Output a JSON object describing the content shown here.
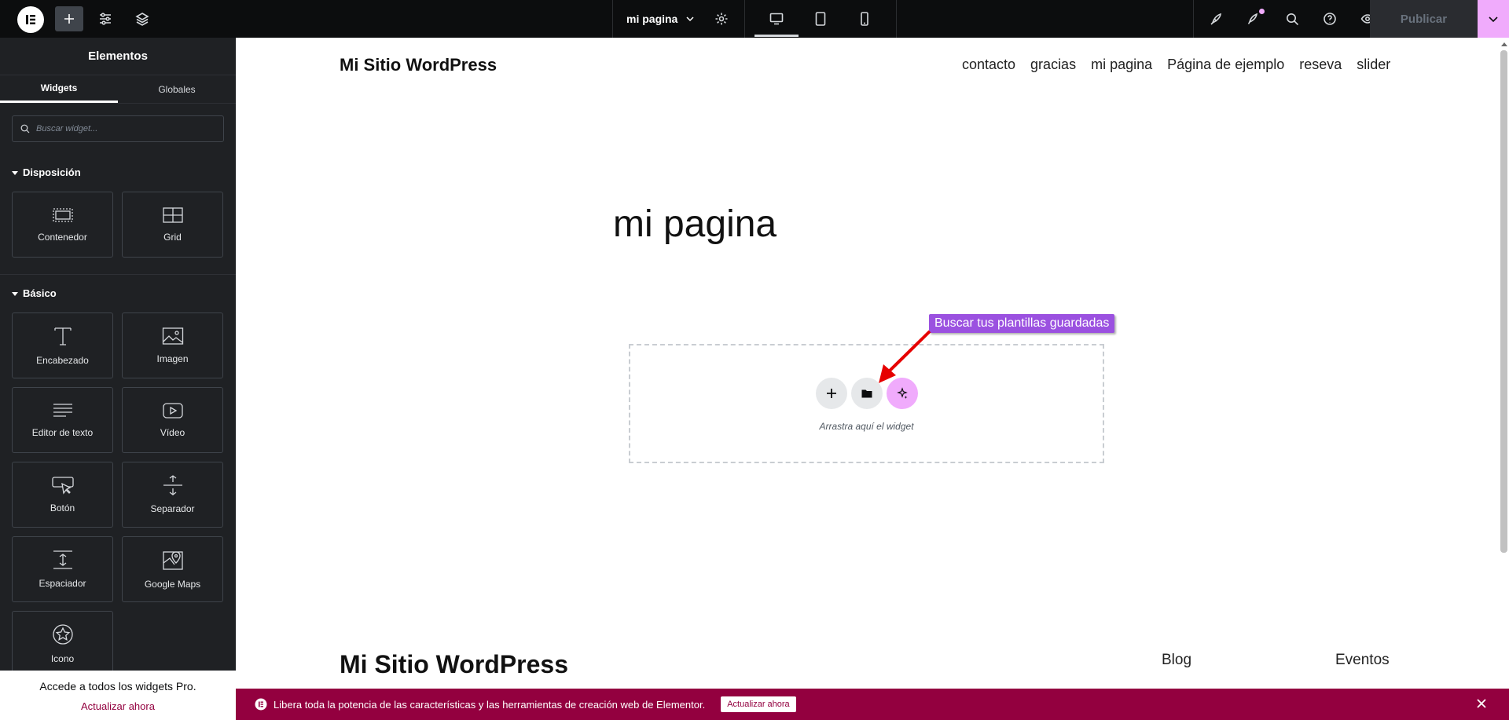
{
  "topbar": {
    "page_name": "mi pagina",
    "publish_label": "Publicar"
  },
  "panel": {
    "title": "Elementos",
    "tabs": [
      "Widgets",
      "Globales"
    ],
    "search_placeholder": "Buscar widget...",
    "categories": [
      {
        "title": "Disposición",
        "widgets": [
          "Contenedor",
          "Grid"
        ]
      },
      {
        "title": "Básico",
        "widgets": [
          "Encabezado",
          "Imagen",
          "Editor de texto",
          "Vídeo",
          "Botón",
          "Separador",
          "Espaciador",
          "Google Maps",
          "Icono"
        ]
      }
    ],
    "pro": {
      "text": "Accede a todos los widgets Pro.",
      "link": "Actualizar ahora"
    }
  },
  "canvas": {
    "site_title": "Mi Sitio WordPress",
    "nav": [
      "contacto",
      "gracias",
      "mi pagina",
      "Página de ejemplo",
      "reseva",
      "slider"
    ],
    "page_heading": "mi pagina",
    "dropzone_hint": "Arrastra aquí el widget",
    "annotation": "Buscar tus plantillas guardadas",
    "footer_title": "Mi Sitio WordPress",
    "footer_links": [
      "Blog",
      "Eventos"
    ]
  },
  "promo": {
    "text": "Libera toda la potencia de las características y las herramientas de creación web de Elementor.",
    "button": "Actualizar ahora"
  },
  "colors": {
    "brand_pink": "#f0abfc",
    "promo_bg": "#93003f",
    "annotation_bg": "#9b51e0"
  }
}
